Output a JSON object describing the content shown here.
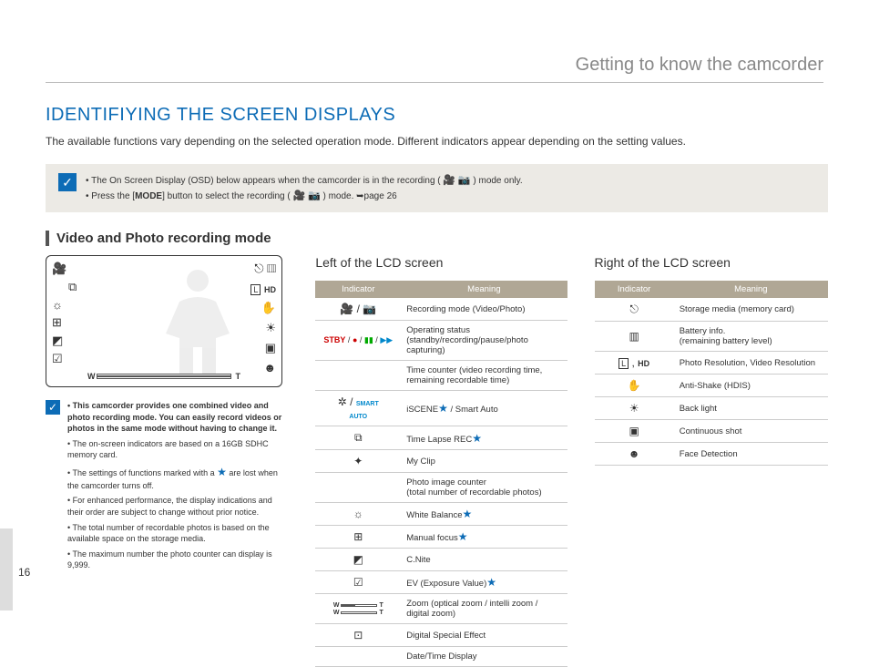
{
  "page_number": "16",
  "top_header": "Getting to know the camcorder",
  "h1": "IDENTIFIYING THE SCREEN DISPLAYS",
  "intro": "The available functions vary depending on the selected operation mode. Different indicators appear depending on the setting values.",
  "note_box": {
    "item1_a": "The On Screen Display (OSD) below appears when the camcorder is in the recording (",
    "item1_b": ") mode only.",
    "item2_a": "Press the [",
    "item2_b": "MODE",
    "item2_c": "] button to select the recording (",
    "item2_d": ") mode. ➥page 26"
  },
  "section_title": "Video and Photo recording mode",
  "lcd": {
    "w": "W",
    "t": "T"
  },
  "small_note": {
    "li1": "This camcorder provides one combined video and photo recording mode. You can easily record videos or photos in the same mode without having to change it.",
    "li2": "The on-screen indicators are based on a 16GB SDHC memory card.",
    "li3_a": "The settings of functions marked with a ",
    "li3_b": " are lost when the camcorder turns off.",
    "li4": "For enhanced performance, the display indications and their order are subject to change without prior notice.",
    "li5": "The total number of recordable photos is based on the available space on the storage media.",
    "li6": "The maximum number the photo counter can display is 9,999."
  },
  "left_table": {
    "title": "Left of the LCD screen",
    "h_ind": "Indicator",
    "h_mean": "Meaning",
    "rows": {
      "r1m": "Recording mode (Video/Photo)",
      "r2i": "STBY / ● / ▮▮ / ▶▶",
      "r2m": "Operating status (standby/recording/pause/photo capturing)",
      "r3m": "Time counter (video recording time, remaining recordable time)",
      "r4m_a": "iSCENE",
      "r4m_b": " / Smart Auto",
      "r5m_a": "Time Lapse REC",
      "r6m": "My Clip",
      "r7m": "Photo image counter\n(total number of recordable photos)",
      "r8m_a": "White Balance",
      "r9m_a": "Manual focus",
      "r10m": "C.Nite",
      "r11m_a": "EV (Exposure Value)",
      "r12m": "Zoom (optical zoom / intelli zoom / digital zoom)",
      "r13m": "Digital Special Effect",
      "r14m": "Date/Time Display"
    }
  },
  "right_table": {
    "title": "Right of the LCD screen",
    "h_ind": "Indicator",
    "h_mean": "Meaning",
    "rows": {
      "r1m": "Storage media (memory card)",
      "r2m": "Battery info.\n(remaining battery level)",
      "r3m": "Photo Resolution, Video Resolution",
      "r4m": "Anti-Shake (HDIS)",
      "r5m": "Back light",
      "r6m": "Continuous shot",
      "r7m": "Face Detection"
    }
  }
}
